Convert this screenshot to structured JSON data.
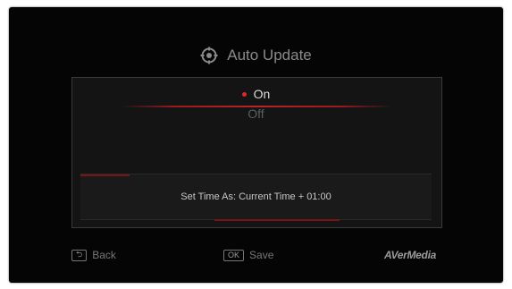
{
  "screen": {
    "title": "Auto Update",
    "title_icon": "auto-update-icon"
  },
  "options": [
    {
      "label": "On",
      "selected": true
    },
    {
      "label": "Off",
      "selected": false
    }
  ],
  "info": {
    "text": "Set Time As: Current Time + 01:00"
  },
  "footer": {
    "back_key": "⮌",
    "back_label": "Back",
    "save_key": "OK",
    "save_label": "Save",
    "brand": "AVerMedia"
  },
  "colors": {
    "accent": "#e0262a",
    "selected_text": "#d9d9d9",
    "unselected_text": "#5e5e5e",
    "background": "#050505"
  }
}
